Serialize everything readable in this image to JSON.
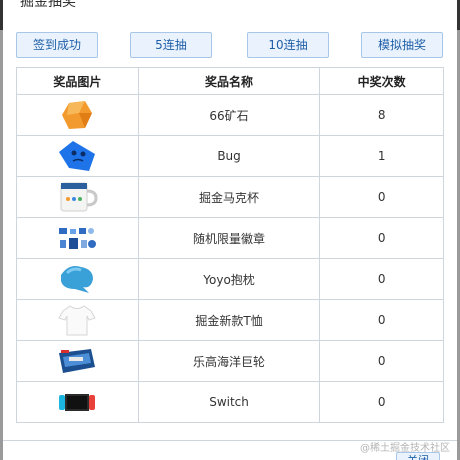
{
  "dialog": {
    "title": "掘金抽奖"
  },
  "buttons": {
    "sign_in": "签到成功",
    "five_draw": "5连抽",
    "ten_draw": "10连抽",
    "start_draw": "模拟抽奖"
  },
  "table": {
    "headers": {
      "image": "奖品图片",
      "name": "奖品名称",
      "count": "中奖次数"
    },
    "rows": [
      {
        "icon": "ore-icon",
        "name": "66矿石",
        "count": "8"
      },
      {
        "icon": "bug-icon",
        "name": "Bug",
        "count": "1"
      },
      {
        "icon": "mug-icon",
        "name": "掘金马克杯",
        "count": "0"
      },
      {
        "icon": "badge-icon",
        "name": "随机限量徽章",
        "count": "0"
      },
      {
        "icon": "pillow-icon",
        "name": "Yoyo抱枕",
        "count": "0"
      },
      {
        "icon": "tshirt-icon",
        "name": "掘金新款T恤",
        "count": "0"
      },
      {
        "icon": "lego-box-icon",
        "name": "乐高海洋巨轮",
        "count": "0"
      },
      {
        "icon": "switch-console-icon",
        "name": "Switch",
        "count": "0"
      }
    ]
  },
  "footer": {
    "button_label": "关闭",
    "watermark": "@稀土掘金技术社区"
  },
  "colors": {
    "accent": "#1f5fa8",
    "button_bg": "#eaf3fd",
    "border": "#cfd5dc"
  }
}
